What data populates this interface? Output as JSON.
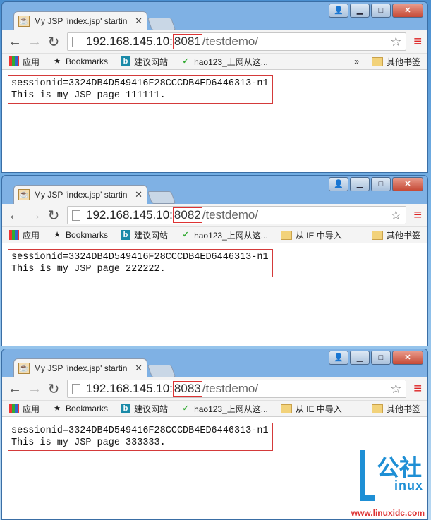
{
  "windows": [
    {
      "tab_title": "My JSP 'index.jsp' startin",
      "url_host": "192.168.145.10:",
      "url_port": "8081",
      "url_path": "/testdemo/",
      "lines": [
        "sessionid=3324DB4D549416F28CCCDB4ED6446313-n1",
        "This is my JSP page 111111."
      ],
      "bookmarks": [
        "应用",
        "Bookmarks",
        "建议网站",
        "hao123_上网从这..."
      ],
      "overflow": "»",
      "other_bookmarks": "其他书签"
    },
    {
      "tab_title": "My JSP 'index.jsp' startin",
      "url_host": "192.168.145.10:",
      "url_port": "8082",
      "url_path": "/testdemo/",
      "lines": [
        "sessionid=3324DB4D549416F28CCCDB4ED6446313-n1",
        "This is my JSP page 222222."
      ],
      "bookmarks": [
        "应用",
        "Bookmarks",
        "建议网站",
        "hao123_上网从这...",
        "从 IE 中导入"
      ],
      "other_bookmarks": "其他书签"
    },
    {
      "tab_title": "My JSP 'index.jsp' startin",
      "url_host": "192.168.145.10:",
      "url_port": "8083",
      "url_path": "/testdemo/",
      "lines": [
        "sessionid=3324DB4D549416F28CCCDB4ED6446313-n1",
        "This is my JSP page 333333."
      ],
      "bookmarks": [
        "应用",
        "Bookmarks",
        "建议网站",
        "hao123_上网从这...",
        "从 IE 中导入"
      ],
      "other_bookmarks": "其他书签"
    }
  ],
  "watermark": {
    "big_text": "公社",
    "brand_text": "inux",
    "url": "www.linuxidc.com"
  },
  "colors": {
    "highlight_border": "#d43a3a",
    "watermark_blue": "#1e8fd5"
  }
}
